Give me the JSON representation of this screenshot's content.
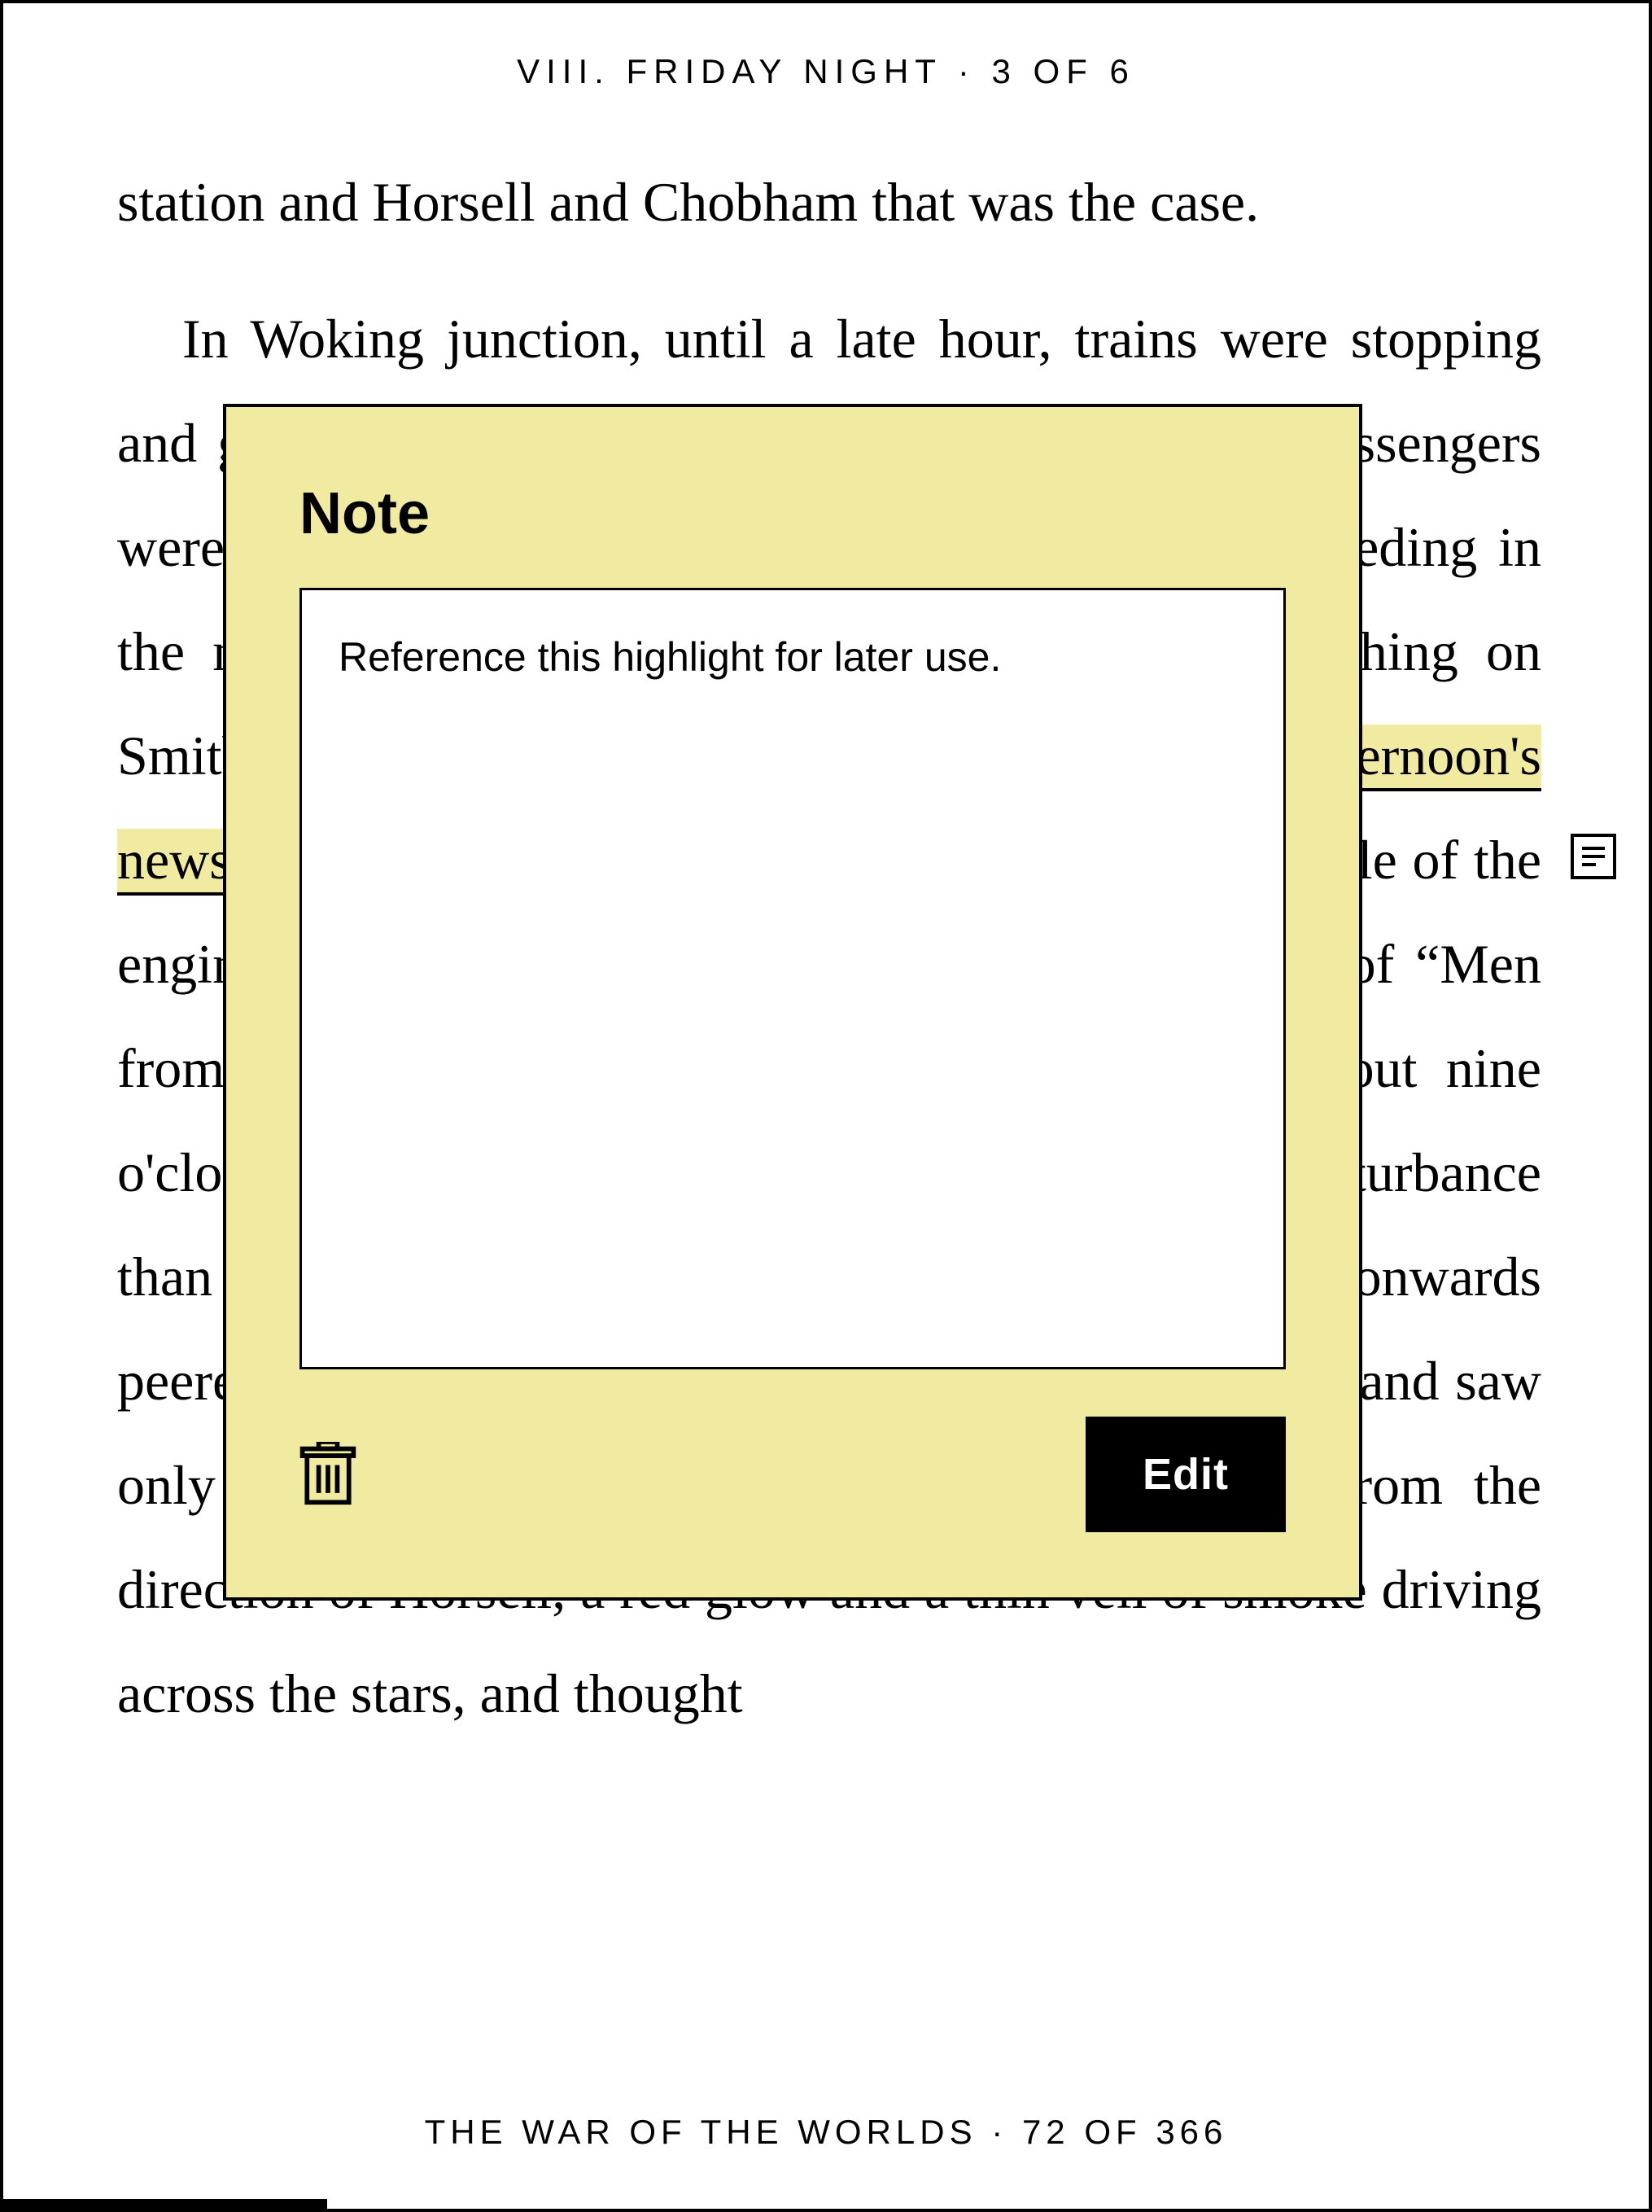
{
  "header": {
    "chapter": "VIII. FRIDAY NIGHT",
    "chapter_page": "3 OF 6"
  },
  "footer": {
    "book_title": "THE WAR OF THE WORLDS",
    "book_page": "72 OF 366",
    "progress_percent": 19.7
  },
  "note_popup": {
    "title": "Note",
    "content": "Reference this highlight for later use.",
    "edit_label": "Edit"
  },
  "text": {
    "para1_tail": "station and Horsell and Chobham that was the case.",
    "p2_before_hl": "In Woking junction, until a late hour, trains were stopping and going on, others were shunting on the sidings, passengers were alighting and waiting, and everything was proceeding in the most ordinary way. A boy from the town, trenching on Smith's monopoly, was selling papers with ",
    "p2_hl": "the afternoon's news. The ringing impact of trucks, the sym",
    "p2_after_hl": "sharp whistle of the engines from the junction, mingled with their shouts of “Men from Mars!” Excited men came into the station about nine o'clock with incredible tidings, and caused no more disturbance than drunkards might have done. People rattling Londonwards peered into the darkness outside the carriage windows, and saw only a rare, flickering, vanishing spark dance up from the direction of Horsell, a red glow and a thin veil of smoke driving across the stars, and thought"
  }
}
